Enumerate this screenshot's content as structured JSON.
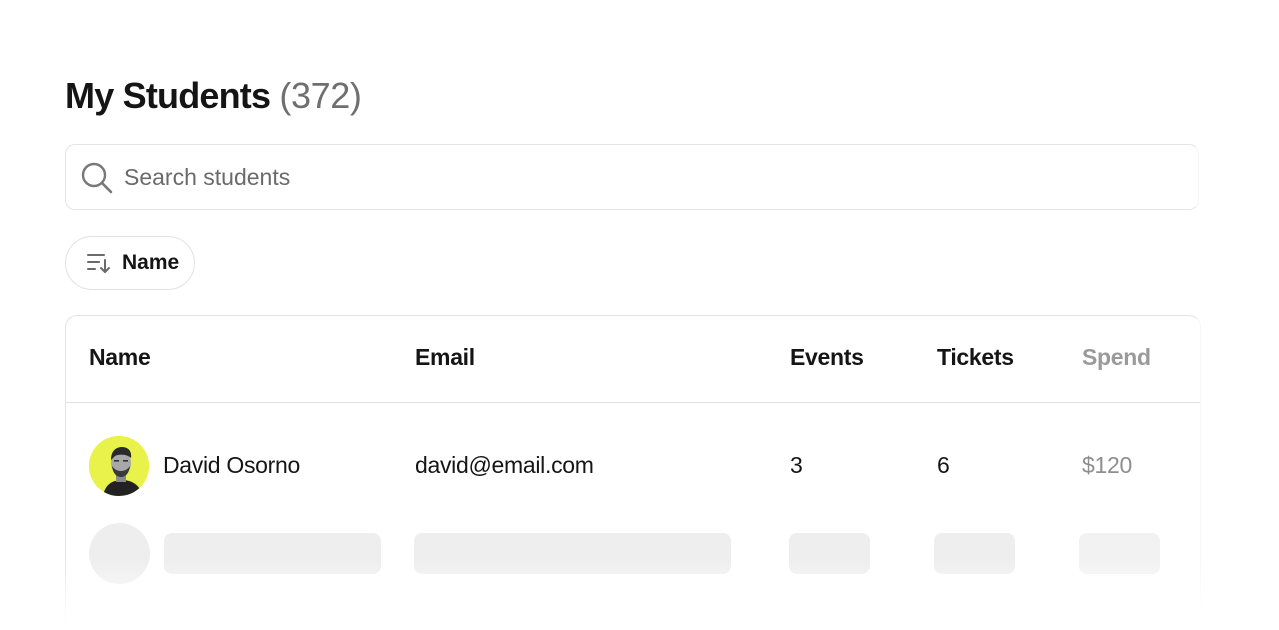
{
  "header": {
    "title": "My Students",
    "count": "(372)"
  },
  "search": {
    "placeholder": "Search students",
    "value": ""
  },
  "sort": {
    "label": "Name",
    "icon": "sort-descending-icon"
  },
  "table": {
    "columns": [
      "Name",
      "Email",
      "Events",
      "Tickets",
      "Spend"
    ],
    "rows": [
      {
        "name": "David Osorno",
        "email": "david@email.com",
        "events": "3",
        "tickets": "6",
        "spend": "$120",
        "avatar_color": "#e9f24a"
      }
    ]
  },
  "colors": {
    "text": "#151515",
    "muted": "#6f6f6f",
    "border": "#e4e4e4",
    "skeleton": "#eeeeee",
    "avatar_bg": "#e9f24a"
  }
}
